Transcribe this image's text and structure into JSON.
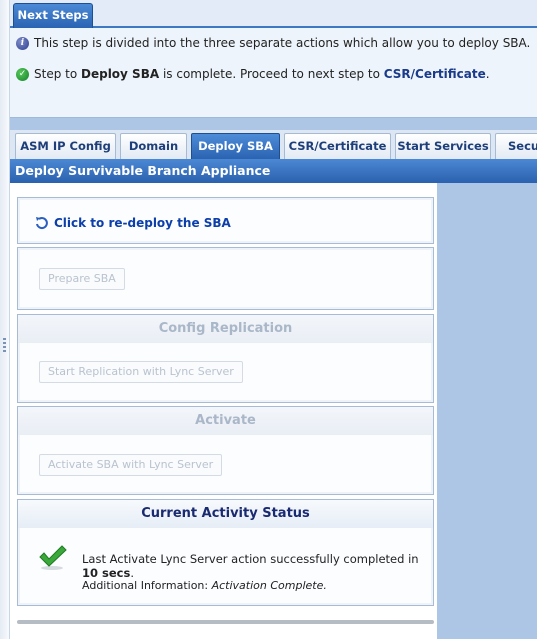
{
  "next_steps": {
    "tab_label": "Next Steps",
    "info_text": "This step is divided into the three separate actions which allow you to deploy SBA.",
    "status_prefix": "Step to ",
    "status_bold": "Deploy SBA",
    "status_middle": " is complete. Proceed to next step to ",
    "status_link": "CSR/Certificate",
    "status_suffix": "."
  },
  "tabs": [
    {
      "label": "ASM IP Config",
      "active": false
    },
    {
      "label": "Domain",
      "active": false
    },
    {
      "label": "Deploy SBA",
      "active": true
    },
    {
      "label": "CSR/Certificate",
      "active": false
    },
    {
      "label": "Start Services",
      "active": false
    },
    {
      "label": "Secur",
      "active": false
    }
  ],
  "section_title": "Deploy Survivable Branch Appliance",
  "redeploy_link": "Click to re-deploy the SBA",
  "prepare": {
    "button": "Prepare SBA"
  },
  "replication": {
    "title": "Config Replication",
    "button": "Start Replication with Lync Server"
  },
  "activate": {
    "title": "Activate",
    "button": "Activate SBA with Lync Server"
  },
  "status": {
    "title": "Current Activity Status",
    "message_prefix": "Last Activate Lync Server action successfully completed in ",
    "message_bold": "10 secs",
    "message_suffix": ".",
    "info_label": "Additional Information: ",
    "info_value": "Activation Complete."
  },
  "colors": {
    "accent": "#2b63b1",
    "link": "#0c3fa9",
    "success": "#3aa83a"
  }
}
